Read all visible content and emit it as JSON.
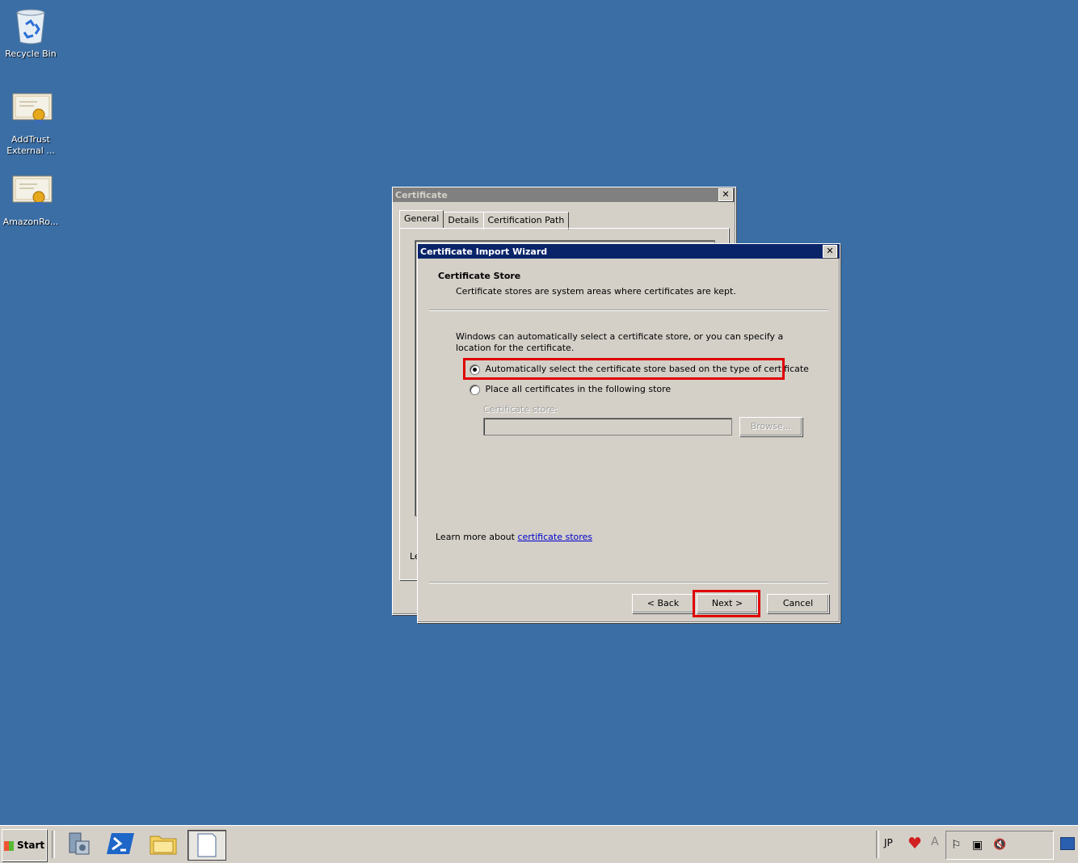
{
  "desktop": {
    "icons": [
      {
        "label": "Recycle Bin",
        "icon": "recycle-bin-icon"
      },
      {
        "label": "AddTrust\nExternal ...",
        "icon": "certificate-icon"
      },
      {
        "label": "AmazonRo...",
        "icon": "certificate-icon"
      }
    ]
  },
  "cert_window": {
    "title": "Certificate",
    "tabs": [
      "General",
      "Details",
      "Certification Path"
    ],
    "partial_text": "Le"
  },
  "wizard": {
    "title": "Certificate Import Wizard",
    "header_title": "Certificate Store",
    "header_desc": "Certificate stores are system areas where certificates are kept.",
    "intro": "Windows can automatically select a certificate store, or you can specify a location for the certificate.",
    "option_auto": "Automatically select the certificate store based on the type of certificate",
    "option_manual": "Place all certificates in the following store",
    "store_label": "Certificate store:",
    "store_value": "",
    "browse_label": "Browse...",
    "learn_prefix": "Learn more about ",
    "learn_link": "certificate stores",
    "back_label": "< Back",
    "next_label": "Next >",
    "cancel_label": "Cancel",
    "selected_option": "auto"
  },
  "taskbar": {
    "start_label": "Start",
    "lang": "JP"
  },
  "colors": {
    "desktop": "#3a6ea5",
    "active_title": "#0a246a",
    "highlight": "#e00000",
    "link": "#0000cc"
  }
}
